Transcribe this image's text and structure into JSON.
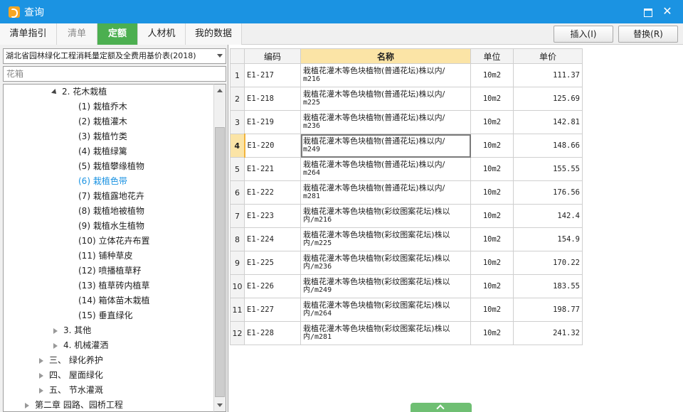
{
  "window": {
    "title": "查询"
  },
  "tabs": [
    {
      "label": "清单指引"
    },
    {
      "label": "清单"
    },
    {
      "label": "定额"
    },
    {
      "label": "人材机"
    },
    {
      "label": "我的数据"
    }
  ],
  "actions": {
    "insert_label": "插入(I)",
    "replace_label": "替换(R)"
  },
  "left": {
    "dropdown_value": "湖北省园林绿化工程消耗量定额及全费用基价表(2018)",
    "search_value": "花箱",
    "tree": [
      {
        "label": "2. 花木栽植"
      },
      {
        "label": "(1) 栽植乔木"
      },
      {
        "label": "(2) 栽植灌木"
      },
      {
        "label": "(3) 栽植竹类"
      },
      {
        "label": "(4) 栽植绿篱"
      },
      {
        "label": "(5) 栽植攀缘植物"
      },
      {
        "label": "(6) 栽植色带"
      },
      {
        "label": "(7) 栽植露地花卉"
      },
      {
        "label": "(8) 栽植地被植物"
      },
      {
        "label": "(9) 栽植水生植物"
      },
      {
        "label": "(10) 立体花卉布置"
      },
      {
        "label": "(11) 铺种草皮"
      },
      {
        "label": "(12) 喷播植草籽"
      },
      {
        "label": "(13) 植草砖内植草"
      },
      {
        "label": "(14) 箱体苗木栽植"
      },
      {
        "label": "(15) 垂直绿化"
      },
      {
        "label": "3. 其他"
      },
      {
        "label": "4. 机械灌洒"
      },
      {
        "label": "三、 绿化养护"
      },
      {
        "label": "四、 屋面绿化"
      },
      {
        "label": "五、 节水灌溉"
      },
      {
        "label": "第二章 园路、园桥工程"
      }
    ]
  },
  "table": {
    "headers": {
      "code": "编码",
      "name": "名称",
      "unit": "单位",
      "price": "单价"
    },
    "rows": [
      {
        "no": "1",
        "code": "E1-217",
        "name1": "栽植花灌木等色块植物(普通花坛)株以内/",
        "name2": "m216",
        "unit": "10m2",
        "price": "111.37"
      },
      {
        "no": "2",
        "code": "E1-218",
        "name1": "栽植花灌木等色块植物(普通花坛)株以内/",
        "name2": "m225",
        "unit": "10m2",
        "price": "125.69"
      },
      {
        "no": "3",
        "code": "E1-219",
        "name1": "栽植花灌木等色块植物(普通花坛)株以内/",
        "name2": "m236",
        "unit": "10m2",
        "price": "142.81"
      },
      {
        "no": "4",
        "code": "E1-220",
        "name1": "栽植花灌木等色块植物(普通花坛)株以内/",
        "name2": "m249",
        "unit": "10m2",
        "price": "148.66"
      },
      {
        "no": "5",
        "code": "E1-221",
        "name1": "栽植花灌木等色块植物(普通花坛)株以内/",
        "name2": "m264",
        "unit": "10m2",
        "price": "155.55"
      },
      {
        "no": "6",
        "code": "E1-222",
        "name1": "栽植花灌木等色块植物(普通花坛)株以内/",
        "name2": "m281",
        "unit": "10m2",
        "price": "176.56"
      },
      {
        "no": "7",
        "code": "E1-223",
        "name1": "栽植花灌木等色块植物(彩纹图案花坛)株以",
        "name2": "内/m216",
        "unit": "10m2",
        "price": "142.4"
      },
      {
        "no": "8",
        "code": "E1-224",
        "name1": "栽植花灌木等色块植物(彩纹图案花坛)株以",
        "name2": "内/m225",
        "unit": "10m2",
        "price": "154.9"
      },
      {
        "no": "9",
        "code": "E1-225",
        "name1": "栽植花灌木等色块植物(彩纹图案花坛)株以",
        "name2": "内/m236",
        "unit": "10m2",
        "price": "170.22"
      },
      {
        "no": "10",
        "code": "E1-226",
        "name1": "栽植花灌木等色块植物(彩纹图案花坛)株以",
        "name2": "内/m249",
        "unit": "10m2",
        "price": "183.55"
      },
      {
        "no": "11",
        "code": "E1-227",
        "name1": "栽植花灌木等色块植物(彩纹图案花坛)株以",
        "name2": "内/m264",
        "unit": "10m2",
        "price": "198.77"
      },
      {
        "no": "12",
        "code": "E1-228",
        "name1": "栽植花灌木等色块植物(彩纹图案花坛)株以",
        "name2": "内/m281",
        "unit": "10m2",
        "price": "241.32"
      }
    ]
  },
  "colors": {
    "titlebar": "#1b93e2",
    "active_tab": "#4caf50",
    "selected_text": "#1b93e2",
    "header_highlight": "#fbe4a6"
  }
}
